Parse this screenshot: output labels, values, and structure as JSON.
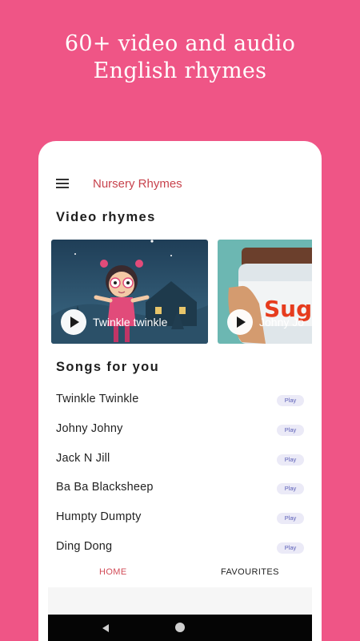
{
  "headline": {
    "line1": "60+ video and audio",
    "line2": "English rhymes"
  },
  "app": {
    "title": "Nursery Rhymes",
    "menu_icon": "hamburger-menu-icon"
  },
  "video_section": {
    "title": "Video rhymes",
    "items": [
      {
        "label": "Twinkle twinkle"
      },
      {
        "label": "Johny Jo",
        "art_text": "Sug"
      }
    ]
  },
  "songs_section": {
    "title": "Songs for you",
    "items": [
      {
        "name": "Twinkle Twinkle",
        "action": "Play"
      },
      {
        "name": "Johny Johny",
        "action": "Play"
      },
      {
        "name": "Jack N Jill",
        "action": "Play"
      },
      {
        "name": "Ba Ba Blacksheep",
        "action": "Play"
      },
      {
        "name": "Humpty Dumpty",
        "action": "Play"
      },
      {
        "name": "Ding Dong",
        "action": "Play"
      }
    ]
  },
  "tabs": {
    "home": "HOME",
    "favourites": "FAVOURITES",
    "active": "home"
  },
  "colors": {
    "background": "#ef5586",
    "accent": "#c8434d",
    "chip_bg": "#ebeaf7",
    "chip_text": "#5b5fb8"
  }
}
